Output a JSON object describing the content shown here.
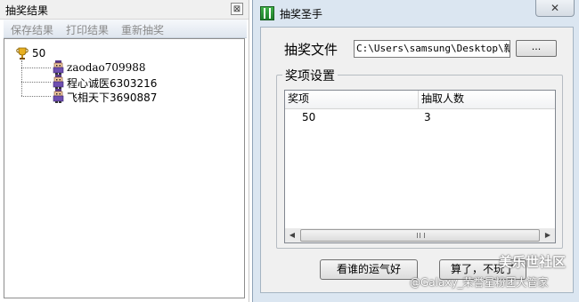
{
  "left_panel": {
    "title": "抽奖结果",
    "close_glyph": "⊠",
    "menu": [
      "保存结果",
      "打印结果",
      "重新抽奖"
    ],
    "tree": {
      "root_label": "50",
      "root_icon": "trophy-icon",
      "children": [
        "zaodao709988",
        "程心诚医6303216",
        "飞相天下3690887"
      ],
      "child_icon": "user-icon"
    }
  },
  "dialog": {
    "title": "抽奖圣手",
    "close_glyph": "✕",
    "file_label": "抽奖文件",
    "file_path": "C:\\Users\\samsung\\Desktop\\新建",
    "browse_label": "...",
    "group_title": "奖项设置",
    "table": {
      "columns": [
        "奖项",
        "抽取人数"
      ],
      "rows": [
        [
          "50",
          "3"
        ]
      ]
    },
    "buttons": {
      "luck": "看谁的运气好",
      "quit": "算了，不玩了"
    }
  },
  "watermark": {
    "site": "美乐世社区",
    "credit": "@Galaxy_荣誉星粉团大管家"
  },
  "colors": {
    "window_frame": "#dbe6f1",
    "client_bg": "#f0f0f0",
    "app_icon": "#2e9a3a"
  }
}
